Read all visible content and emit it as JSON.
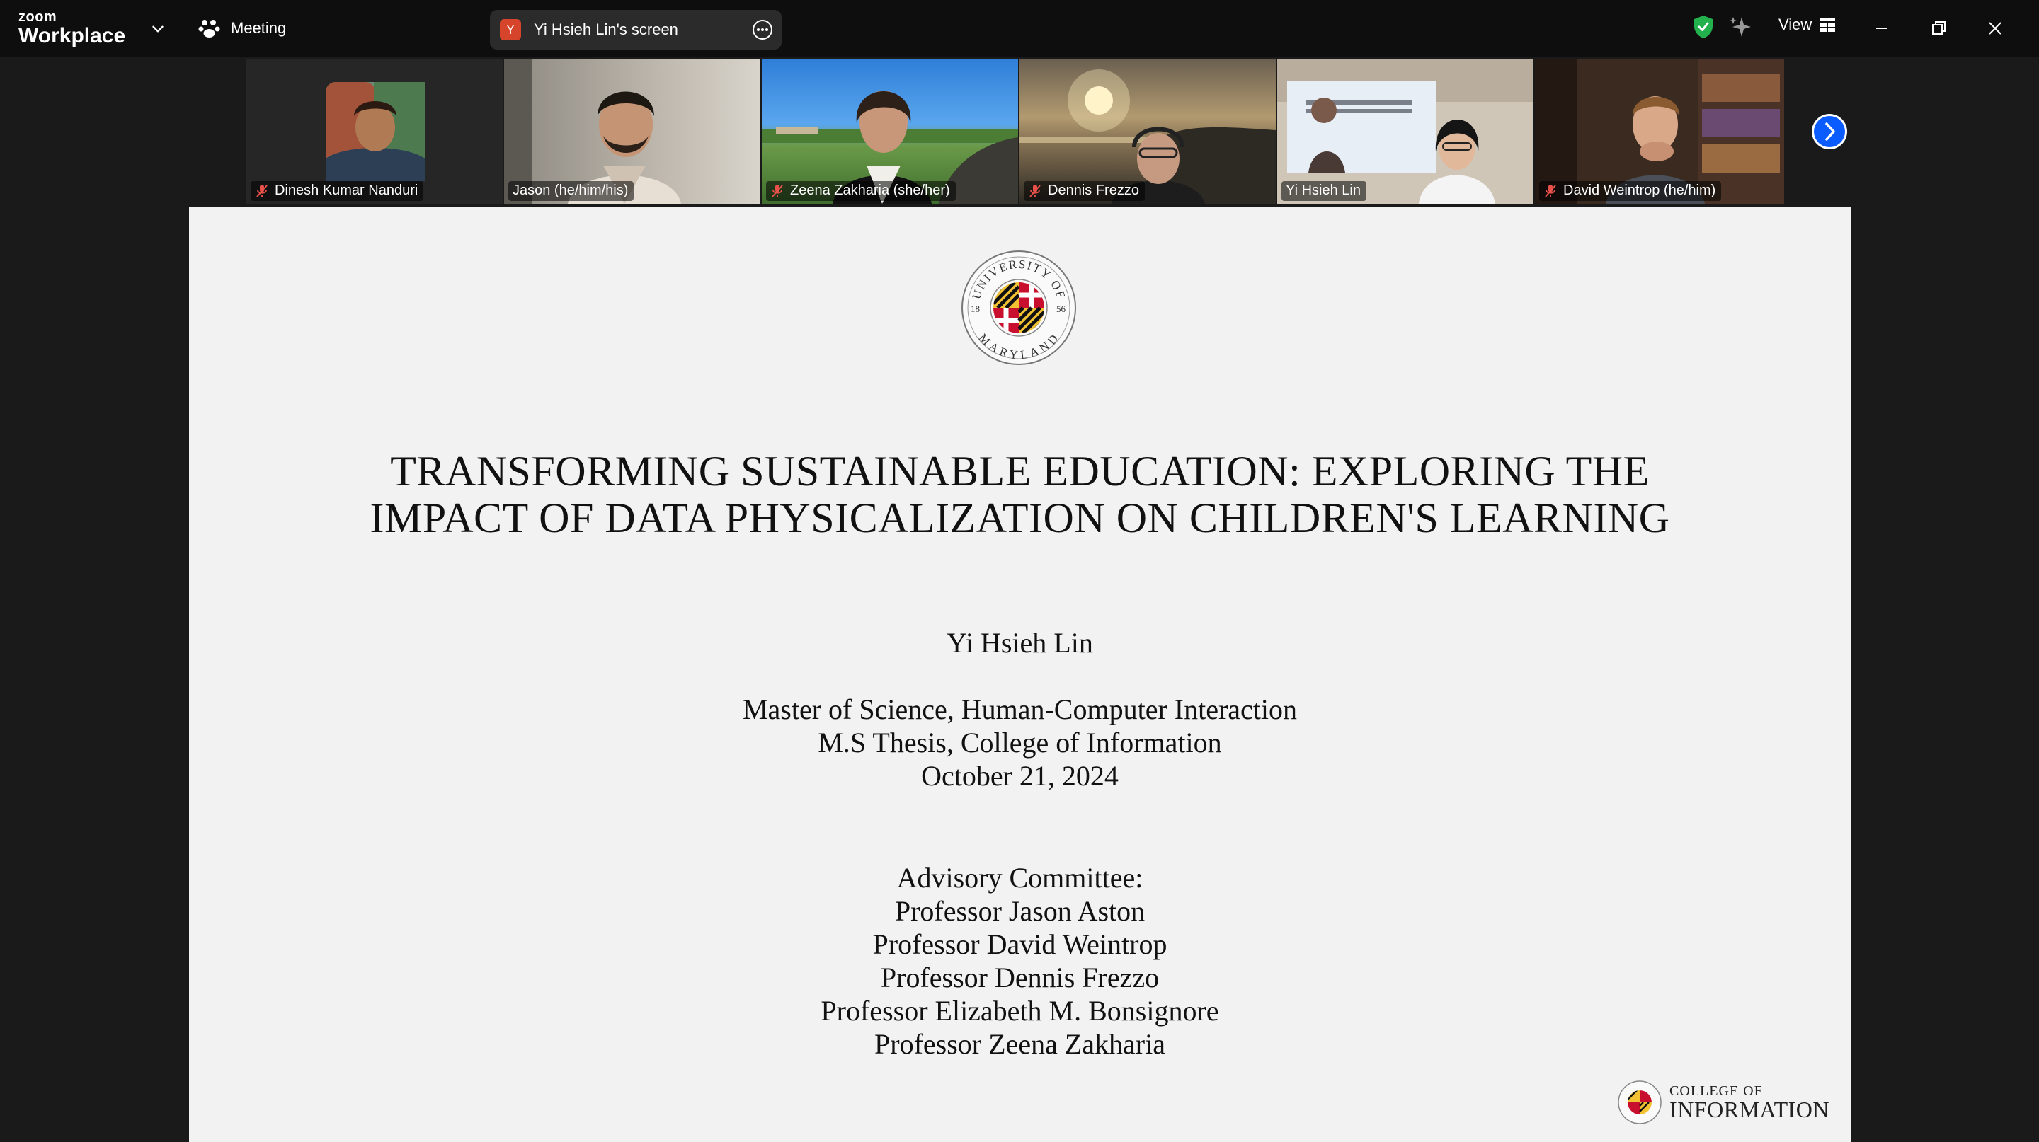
{
  "app": {
    "brand_small": "zoom",
    "brand_large": "Workplace",
    "meeting_label": "Meeting",
    "share_initial": "Y",
    "share_label": "Yi Hsieh Lin's screen",
    "view_label": "View"
  },
  "participants": [
    {
      "name": "Dinesh Kumar Nanduri",
      "muted": true,
      "active": false
    },
    {
      "name": "Jason (he/him/his)",
      "muted": false,
      "active": false
    },
    {
      "name": "Zeena Zakharia (she/her)",
      "muted": true,
      "active": false
    },
    {
      "name": "Dennis Frezzo",
      "muted": true,
      "active": false
    },
    {
      "name": "Yi Hsieh Lin",
      "muted": false,
      "active": true
    },
    {
      "name": "David Weintrop (he/him)",
      "muted": true,
      "active": false
    }
  ],
  "slide": {
    "seal_top": "UNIVERSITY OF",
    "seal_bottom": "MARYLAND",
    "seal_left": "18",
    "seal_right": "56",
    "title_line1": "TRANSFORMING SUSTAINABLE EDUCATION: EXPLORING THE",
    "title_line2": "IMPACT OF DATA PHYSICALIZATION ON CHILDREN'S LEARNING",
    "presenter": "Yi Hsieh Lin",
    "degree_line1": "Master of Science, Human-Computer Interaction",
    "degree_line2": "M.S Thesis, College of Information",
    "degree_line3": "October 21, 2024",
    "committee": [
      "Advisory Committee:",
      "Professor Jason Aston",
      "Professor David Weintrop",
      "Professor Dennis Frezzo",
      "Professor Elizabeth M. Bonsignore",
      "Professor Zeena Zakharia"
    ],
    "college_line1": "COLLEGE OF",
    "college_line2": "INFORMATION"
  },
  "colors": {
    "active_speaker": "#23d18b",
    "muted_icon": "#e8514a",
    "next_button": "#0b5cff",
    "secure_shield": "#23b14d"
  },
  "icons": [
    "chevron-down-icon",
    "meeting-paw-icon",
    "more-icon",
    "shield-check-icon",
    "sparkle-icon",
    "view-grid-icon",
    "minimize-icon",
    "restore-icon",
    "close-icon",
    "mic-muted-icon",
    "chevron-right-icon"
  ]
}
